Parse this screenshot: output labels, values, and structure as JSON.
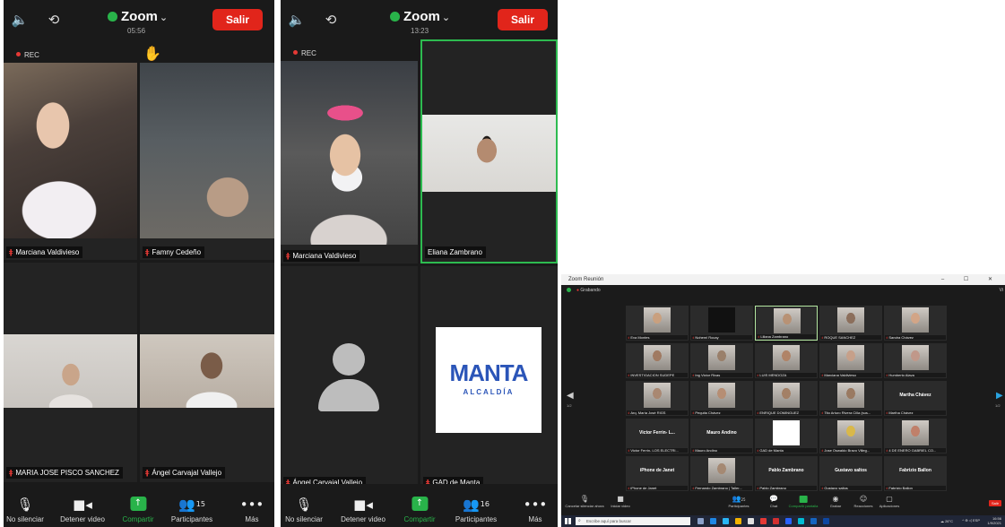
{
  "colors": {
    "leave_red": "#e1251b",
    "zoom_green": "#29b34a",
    "active_border": "#2dbb50",
    "mic_muted": "#e53935",
    "tile_bg": "#232323"
  },
  "phone1": {
    "app_name": "Zoom",
    "timer": "05:56",
    "leave_label": "Salir",
    "rec_label": "REC",
    "raised_hand_icon": "raised-hand-icon",
    "participants": [
      {
        "name": "Marciana Valdivieso"
      },
      {
        "name": "Famny Cedeño"
      },
      {
        "name": "MARIA JOSE PISCO SANCHEZ"
      },
      {
        "name": "Ángel Carvajal Vallejo"
      }
    ],
    "toolbar": {
      "mute": "No silenciar",
      "video": "Detener video",
      "share": "Compartir",
      "participants": "Participantes",
      "participants_count": "15",
      "more": "Más"
    }
  },
  "phone2": {
    "app_name": "Zoom",
    "timer": "13:23",
    "leave_label": "Salir",
    "rec_label": "REC",
    "participants": [
      {
        "name": "Marciana Valdivieso"
      },
      {
        "name": "Eliana Zambrano"
      },
      {
        "name": "Ángel Carvajal Vallejo"
      },
      {
        "name": "GAD de Manta"
      }
    ],
    "logo": {
      "main": "MANTA",
      "sub": "ALCALDÍA"
    },
    "toolbar": {
      "mute": "No silenciar",
      "video": "Detener video",
      "share": "Compartir",
      "participants": "Participantes",
      "participants_count": "16",
      "more": "Más"
    }
  },
  "desktop": {
    "window_title": "Zoom Reunión",
    "window_controls": "– ☐ ✕",
    "rec_label": "Grabando",
    "view_label": "Vi",
    "grid": [
      {
        "label": "Eva Montes"
      },
      {
        "label": "Noheml Rocay"
      },
      {
        "label": "Liliana Zambrano"
      },
      {
        "label": "ROQUE SANCHEZ"
      },
      {
        "label": "Sandra Chávez"
      },
      {
        "label": "INVESTIGACION SUDEPE"
      },
      {
        "label": "Ing Victor Rivas"
      },
      {
        "label": "LUIS MENDOZA"
      },
      {
        "label": "Marciana Valdivieso"
      },
      {
        "label": "Humberto Alava"
      },
      {
        "label": "Arq. María José RIGS"
      },
      {
        "label": "Pequita Chávez"
      },
      {
        "label": "ENRIQUE DOMINGUEZ"
      },
      {
        "label": "Tito Arturo Rivera Cilla (sus..."
      },
      {
        "label": "Martha Chávez",
        "big": "Martha Chávez"
      },
      {
        "label": "Victor Ferrin- LOS ELECTRI...",
        "big": "Victor Ferrin- L..."
      },
      {
        "label": "Mauro Andino",
        "big": "Mauro Andino"
      },
      {
        "label": "GAD de Manta"
      },
      {
        "label": "Jose Oswaldo Bravo Villeg..."
      },
      {
        "label": "4 DE ENERO GABRIEL CO..."
      },
      {
        "label": "iPhone de Janet",
        "big": "iPhone de Janet"
      },
      {
        "label": "Fernando Zambrano | Taller..."
      },
      {
        "label": "Pablo Zambrano",
        "big": "Pablo Zambrano"
      },
      {
        "label": "Gustavo saltos",
        "big": "Gustavo saltos"
      },
      {
        "label": "Fabrizio Ballon",
        "big": "Fabrizio Ballon"
      }
    ],
    "page_left": "1/2",
    "page_right": "1/2",
    "toolbar": {
      "mute": "Cancelar silenciar ahora",
      "video": "Iniciar video",
      "participants": "Participantes",
      "participants_count": "25",
      "chat": "Chat",
      "share": "Compartir pantalla",
      "record": "Grabar",
      "reactions": "Reacciones",
      "apps": "Aplicaciones",
      "leave": "Salir"
    },
    "taskbar": {
      "search_placeholder": "Escribe aquí para buscar",
      "weather": "26°C",
      "tray": "^ ⊕ ◁ ESP",
      "time": "16:56",
      "date": "1/9/2021"
    }
  }
}
